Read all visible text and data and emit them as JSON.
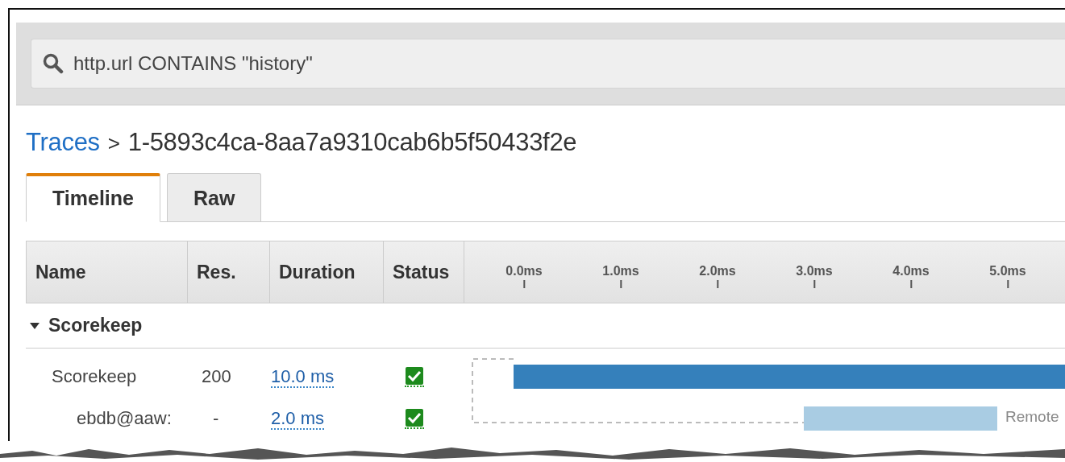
{
  "search": {
    "value": "http.url CONTAINS \"history\""
  },
  "breadcrumb": {
    "link": "Traces",
    "separator": ">",
    "current": "1-5893c4ca-8aa7a9310cab6b5f50433f2e"
  },
  "tabs": [
    {
      "label": "Timeline",
      "selected": true
    },
    {
      "label": "Raw",
      "selected": false
    }
  ],
  "table": {
    "columns": [
      "Name",
      "Res.",
      "Duration",
      "Status"
    ],
    "timeline_ticks": [
      "0.0ms",
      "1.0ms",
      "2.0ms",
      "3.0ms",
      "4.0ms",
      "5.0ms"
    ],
    "group": {
      "name": "Scorekeep",
      "expanded": true
    },
    "rows": [
      {
        "kind": "segment",
        "name": "Scorekeep",
        "response": "200",
        "duration": "10.0 ms",
        "status_ok": true
      },
      {
        "kind": "subsegment",
        "name": "ebdb@aaw:",
        "response": "-",
        "duration": "2.0 ms",
        "status_ok": true,
        "bar_label": "Remote"
      }
    ]
  }
}
